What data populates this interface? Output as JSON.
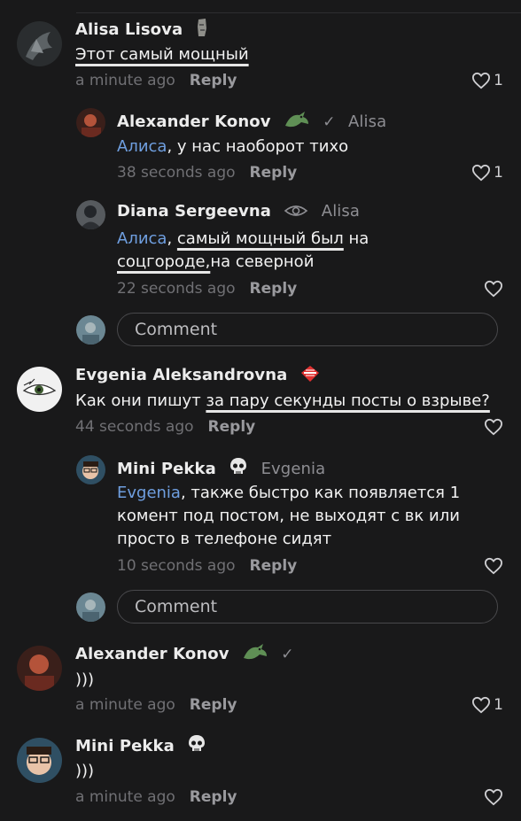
{
  "comments": [
    {
      "author": "Alisa Lisova",
      "badge": "moai-icon",
      "text_plain": "",
      "text_ul": "Этот самый мощный",
      "time": "a minute ago",
      "reply": "Reply",
      "likes": "1"
    },
    {
      "author": "Alexander Konov",
      "badge": "dragon-icon",
      "check": "✓",
      "reply_to": "Alisa",
      "mention": "Алиса",
      "text": ", у нас наоборот тихо",
      "time": "38 seconds ago",
      "reply": "Reply",
      "likes": "1"
    },
    {
      "author": "Diana Sergeevna",
      "badge": "eye-icon",
      "reply_to": "Alisa",
      "mention": "Алиса",
      "text_a": ", ",
      "text_ul1": "самый мощный был",
      "text_b": " на ",
      "text_ul2": "соцгороде,",
      "text_c": "на северной",
      "time": "22 seconds ago",
      "reply": "Reply",
      "likes": ""
    },
    {
      "author": "Evgenia Aleksandrovna",
      "badge": "spartak-icon",
      "text_a": "Как они пишут ",
      "text_ul": "за пару секунды посты о взрыве?",
      "time": "44 seconds ago",
      "reply": "Reply",
      "likes": ""
    },
    {
      "author": "Mini Pekka",
      "badge": "skull-icon",
      "reply_to": "Evgenia",
      "mention": "Evgenia",
      "text": ", также быстро как появляется 1 комент под постом, не выходят с вк или просто в телефоне сидят",
      "time": "10 seconds ago",
      "reply": "Reply",
      "likes": ""
    },
    {
      "author": "Alexander Konov",
      "badge": "dragon-icon",
      "check": "✓",
      "text": ")))",
      "time": "a minute ago",
      "reply": "Reply",
      "likes": "1"
    },
    {
      "author": "Mini Pekka",
      "badge": "skull-icon",
      "text": ")))",
      "time": "a minute ago",
      "reply": "Reply",
      "likes": ""
    }
  ],
  "comment_input": {
    "placeholder": "Comment"
  },
  "colors": {
    "background": "#19191a",
    "mention": "#6f9fe0",
    "meta": "#707074"
  }
}
